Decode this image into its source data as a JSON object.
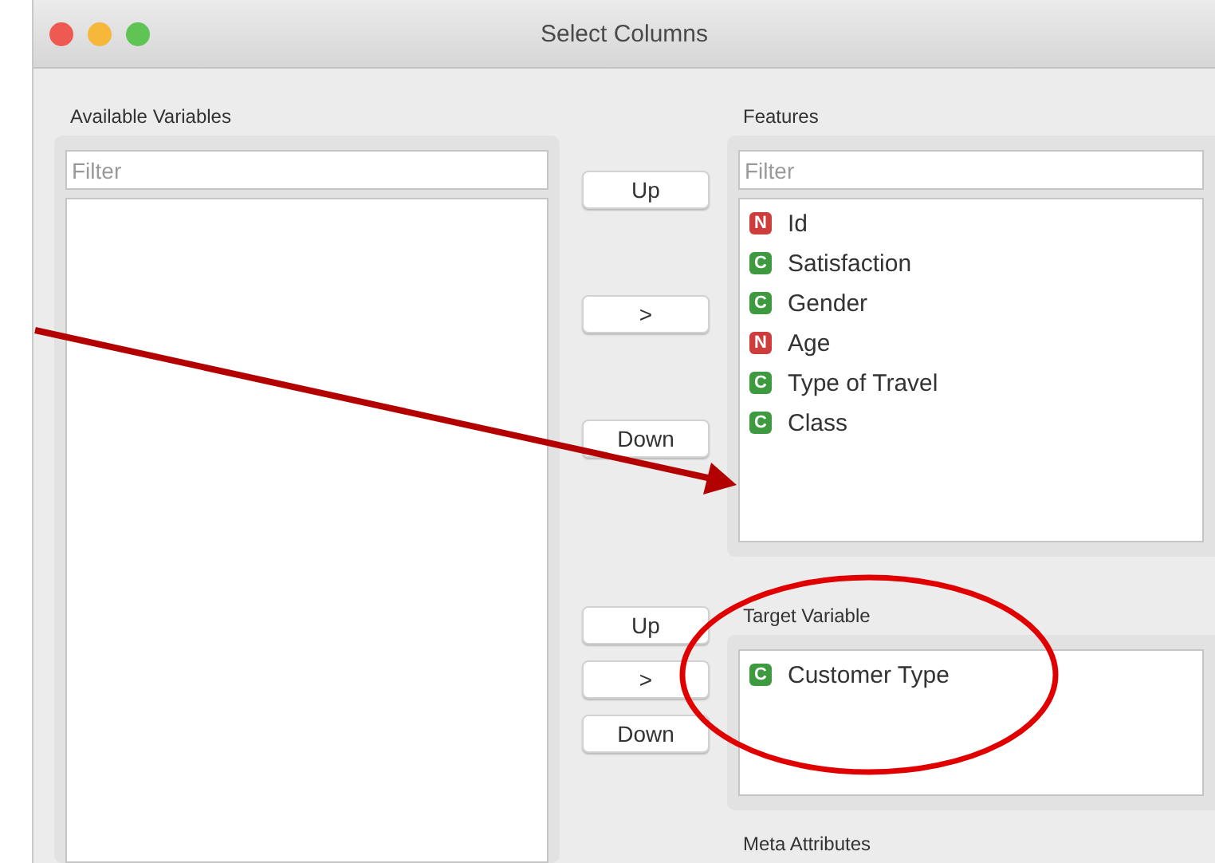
{
  "window": {
    "title": "Select Columns"
  },
  "available_variables": {
    "title": "Available Variables",
    "filter": {
      "placeholder": "Filter"
    }
  },
  "middle_buttons_top": [
    "Up",
    ">",
    "Down"
  ],
  "features": {
    "title": "Features",
    "filter": {
      "placeholder": "Filter"
    },
    "items": [
      {
        "badge": "N",
        "kind": "numeric",
        "name": "Id"
      },
      {
        "badge": "C",
        "kind": "categorical",
        "name": "Satisfaction"
      },
      {
        "badge": "C",
        "kind": "categorical",
        "name": "Gender"
      },
      {
        "badge": "N",
        "kind": "numeric",
        "name": "Age"
      },
      {
        "badge": "C",
        "kind": "categorical",
        "name": "Type of Travel"
      },
      {
        "badge": "C",
        "kind": "categorical",
        "name": "Class"
      }
    ]
  },
  "middle_buttons_bottom": [
    "Up",
    ">",
    "Down"
  ],
  "target_variable": {
    "title": "Target Variable",
    "items": [
      {
        "badge": "C",
        "kind": "categorical",
        "name": "Customer Type"
      }
    ]
  },
  "meta_attributes": {
    "title": "Meta Attributes"
  }
}
